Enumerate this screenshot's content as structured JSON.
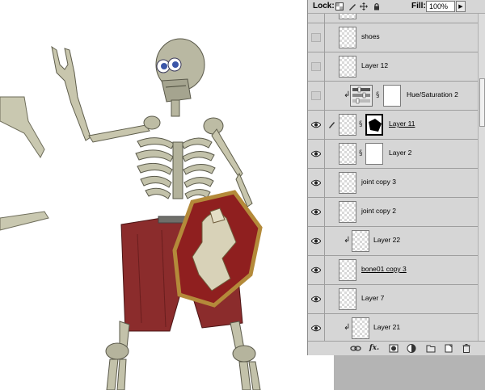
{
  "panel": {
    "lock_label": "Lock:",
    "lock_icons": [
      "lock-transparent-pixels-icon",
      "lock-image-pixels-icon",
      "lock-position-icon",
      "lock-all-icon"
    ],
    "fill_label": "Fill:",
    "fill_value": "100%"
  },
  "layers": [
    {
      "name": "",
      "visible": false,
      "type": "pixel"
    },
    {
      "name": "shoes",
      "visible": false,
      "type": "pixel"
    },
    {
      "name": "Layer 12",
      "visible": false,
      "type": "pixel"
    },
    {
      "name": "Hue/Saturation 2",
      "visible": false,
      "type": "adjustment",
      "clipped": true
    },
    {
      "name": "Layer 11",
      "visible": true,
      "type": "masked",
      "selected": true
    },
    {
      "name": "Layer 2",
      "visible": true,
      "type": "masked"
    },
    {
      "name": "joint copy 3",
      "visible": true,
      "type": "pixel"
    },
    {
      "name": "joint copy 2",
      "visible": true,
      "type": "pixel"
    },
    {
      "name": "Layer 22",
      "visible": true,
      "type": "pixel",
      "clipped": true
    },
    {
      "name": "bone01 copy 3",
      "visible": true,
      "type": "pixel",
      "underlined": true
    },
    {
      "name": "Layer 7",
      "visible": true,
      "type": "pixel"
    },
    {
      "name": "Layer 21",
      "visible": true,
      "type": "pixel",
      "clipped": true
    }
  ],
  "footer_icons": [
    "link-layers-icon",
    "layer-style-fx-icon",
    "add-mask-icon",
    "adjustment-layer-icon",
    "new-group-icon",
    "new-layer-icon",
    "trash-icon"
  ],
  "footer_fx_label": "fx.",
  "colors": {
    "panel_bg": "#d6d6d6",
    "shorts": "#8b2c2c",
    "shield_red": "#8f1f1f",
    "shield_gold": "#b48a3a",
    "bone": "#c9c8b0"
  }
}
